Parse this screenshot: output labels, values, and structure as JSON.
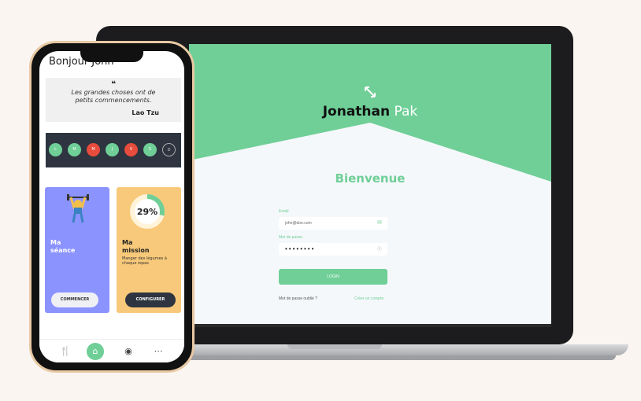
{
  "laptop": {
    "logo_icon": "expand-arrows-icon",
    "brand_bold": "Jonathan",
    "brand_light": " Pak",
    "welcome": "Bienvenue",
    "email_label": "Email",
    "email_value": "john@doe.com",
    "password_label": "Mot de passe",
    "password_value": "••••••••",
    "login_button": "LOGIN",
    "forgot_link": "Mot de passe oublié ?",
    "create_link": "Créer un compte",
    "accent": "#6fcf97"
  },
  "phone": {
    "greeting": "Bonjour John",
    "quote_mark": "❝",
    "quote_text": "Les grandes choses ont de petits commencements.",
    "quote_author": "Lao Tzu",
    "days": [
      {
        "label": "L",
        "color": "#6fcf97"
      },
      {
        "label": "M",
        "color": "#6fcf97"
      },
      {
        "label": "M",
        "color": "#e74c3c"
      },
      {
        "label": "J",
        "color": "#6fcf97"
      },
      {
        "label": "V",
        "color": "#e74c3c"
      },
      {
        "label": "S",
        "color": "#6fcf97"
      },
      {
        "label": "D",
        "color": "none"
      }
    ],
    "session_card": {
      "title_line1": "Ma",
      "title_line2": "séance",
      "button": "COMMENCER"
    },
    "mission_card": {
      "progress_label": "29%",
      "progress": 0.29,
      "title_line1": "Ma",
      "title_line2": "mission",
      "subtitle": "Manger des légumes à chaque repas",
      "button": "CONFIGURER"
    },
    "tabs": [
      {
        "icon": "cutlery-icon",
        "glyph": "🍴"
      },
      {
        "icon": "home-icon",
        "glyph": "⌂"
      },
      {
        "icon": "profile-icon",
        "glyph": "◉"
      },
      {
        "icon": "chat-icon",
        "glyph": "⋯"
      }
    ]
  }
}
